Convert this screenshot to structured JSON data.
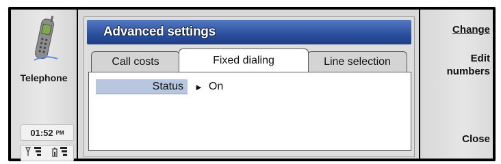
{
  "app": {
    "name": "Telephone",
    "clock_time": "01:52",
    "clock_ampm": "PM"
  },
  "dialog": {
    "title": "Advanced settings",
    "tabs": [
      {
        "label": "Call costs",
        "active": false
      },
      {
        "label": "Fixed dialing",
        "active": true
      },
      {
        "label": "Line selection",
        "active": false
      }
    ],
    "rows": [
      {
        "label": "Status",
        "value": "On"
      }
    ]
  },
  "commands": {
    "change": "Change",
    "edit_numbers": "Edit numbers",
    "close": "Close"
  },
  "icons": {
    "app_icon": "mobile-phone-icon",
    "signal": "signal-strength-icon",
    "battery": "battery-level-icon",
    "row_arrow": "right-arrow-icon"
  },
  "colors": {
    "title_bar": "#2a4f9e",
    "row_highlight": "#b9c6e0"
  }
}
